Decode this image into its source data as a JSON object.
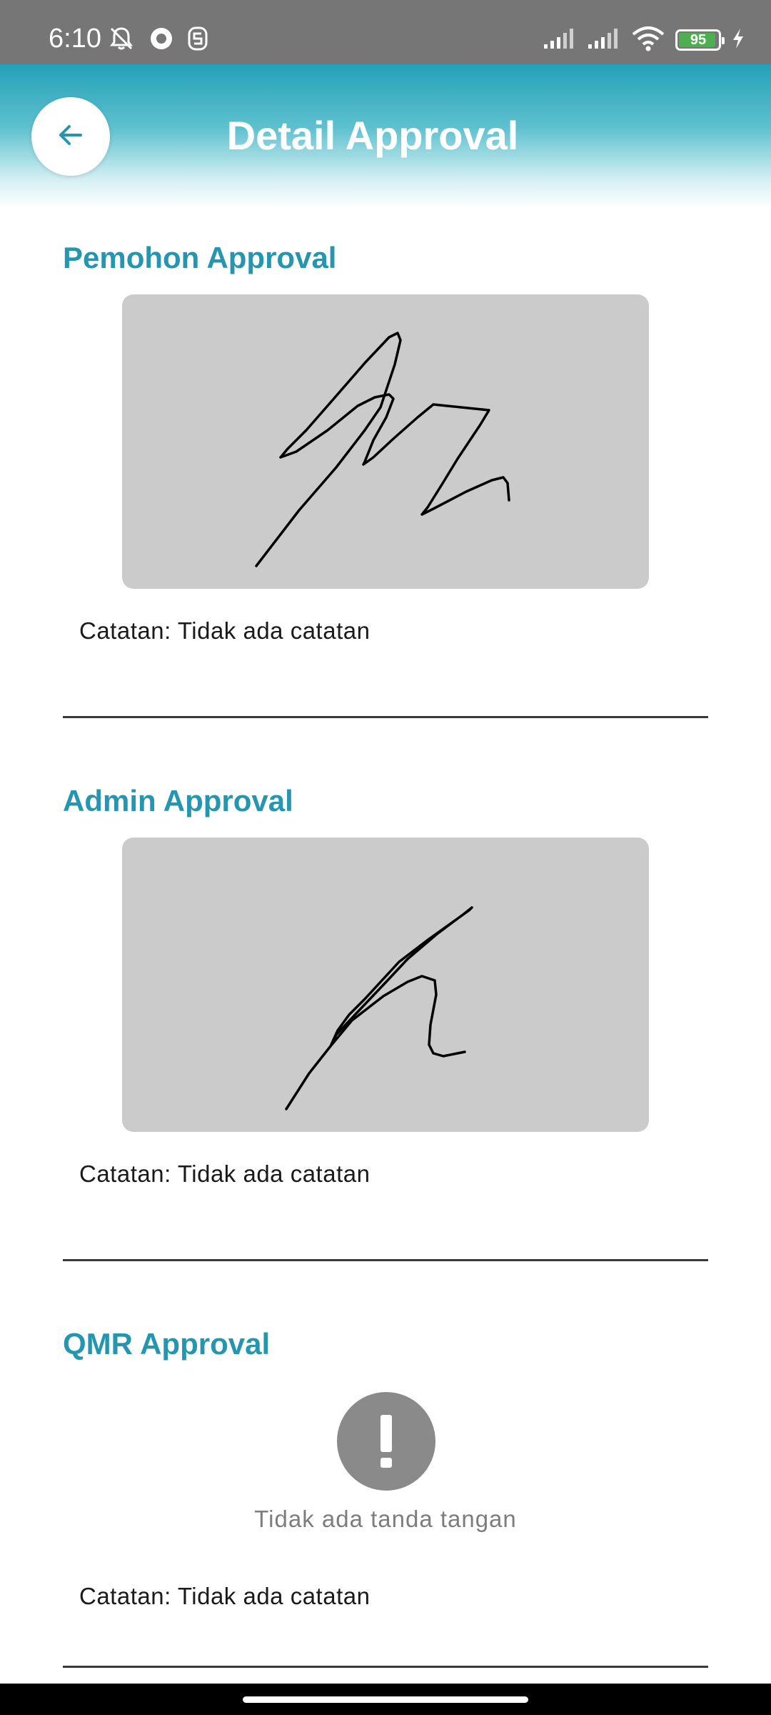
{
  "status_bar": {
    "time": "6:10",
    "battery_level": "95",
    "battery_fraction": 0.95,
    "battery_color": "#4caf50",
    "icons": [
      "mute-bell-icon",
      "record-icon",
      "app-notification-icon",
      "cell-signal-icon",
      "cell-signal-icon",
      "wifi-icon",
      "battery-icon",
      "charging-icon"
    ]
  },
  "header": {
    "title": "Detail Approval",
    "back_icon": "arrow-left-icon",
    "gradient_top": "#23a1b8",
    "gradient_bottom": "#ffffff"
  },
  "colors": {
    "accent": "#2696b0",
    "signature_background": "#cbcbcb",
    "no_signature_icon": "#8a8a8a"
  },
  "sections": [
    {
      "title": "Pemohon Approval",
      "signature": "present",
      "note": "Catatan: Tidak ada catatan"
    },
    {
      "title": "Admin Approval",
      "signature": "present",
      "note": "Catatan: Tidak ada catatan"
    },
    {
      "title": "QMR Approval",
      "signature": "missing",
      "no_signature_icon": "exclamation-icon",
      "no_signature_text": "Tidak ada tanda tangan",
      "note": "Catatan: Tidak ada catatan"
    }
  ]
}
